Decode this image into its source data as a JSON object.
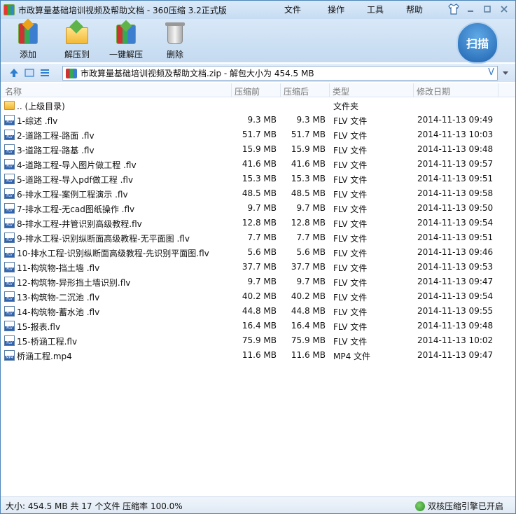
{
  "window": {
    "title": "市政算量基础培训视频及帮助文档 - 360压缩 3.2正式版",
    "menu": [
      "文件",
      "操作",
      "工具",
      "帮助"
    ]
  },
  "toolbar": {
    "add_label": "添加",
    "extract_label": "解压到",
    "one_click_label": "一键解压",
    "delete_label": "删除",
    "scan_label": "扫描"
  },
  "address": {
    "text": "市政算量基础培训视频及帮助文档.zip - 解包大小为 454.5 MB",
    "v_label": "V"
  },
  "columns": {
    "name": "名称",
    "size": "压缩前",
    "packed": "压缩后",
    "type": "类型",
    "date": "修改日期"
  },
  "files": [
    {
      "name": ".. (上级目录)",
      "size": "",
      "packed": "",
      "type": "文件夹",
      "date": "",
      "icon": "folder-icon"
    },
    {
      "name": "1-综述 .flv",
      "size": "9.3 MB",
      "packed": "9.3 MB",
      "type": "FLV 文件",
      "date": "2014-11-13 09:49",
      "icon": "flv-file-icon"
    },
    {
      "name": "2-道路工程-路面 .flv",
      "size": "51.7 MB",
      "packed": "51.7 MB",
      "type": "FLV 文件",
      "date": "2014-11-13 10:03",
      "icon": "flv-file-icon"
    },
    {
      "name": "3-道路工程-路基 .flv",
      "size": "15.9 MB",
      "packed": "15.9 MB",
      "type": "FLV 文件",
      "date": "2014-11-13 09:48",
      "icon": "flv-file-icon"
    },
    {
      "name": "4-道路工程-导入图片做工程 .flv",
      "size": "41.6 MB",
      "packed": "41.6 MB",
      "type": "FLV 文件",
      "date": "2014-11-13 09:57",
      "icon": "flv-file-icon"
    },
    {
      "name": "5-道路工程-导入pdf做工程 .flv",
      "size": "15.3 MB",
      "packed": "15.3 MB",
      "type": "FLV 文件",
      "date": "2014-11-13 09:51",
      "icon": "flv-file-icon"
    },
    {
      "name": "6-排水工程-案例工程演示 .flv",
      "size": "48.5 MB",
      "packed": "48.5 MB",
      "type": "FLV 文件",
      "date": "2014-11-13 09:58",
      "icon": "flv-file-icon"
    },
    {
      "name": "7-排水工程-无cad图纸操作 .flv",
      "size": "9.7 MB",
      "packed": "9.7 MB",
      "type": "FLV 文件",
      "date": "2014-11-13 09:50",
      "icon": "flv-file-icon"
    },
    {
      "name": "8-排水工程-井管识别高级教程.flv",
      "size": "12.8 MB",
      "packed": "12.8 MB",
      "type": "FLV 文件",
      "date": "2014-11-13 09:54",
      "icon": "flv-file-icon"
    },
    {
      "name": "9-排水工程-识别纵断面高级教程-无平面图 .flv",
      "size": "7.7 MB",
      "packed": "7.7 MB",
      "type": "FLV 文件",
      "date": "2014-11-13 09:51",
      "icon": "flv-file-icon"
    },
    {
      "name": "10-排水工程-识别纵断面高级教程-先识别平面图.flv",
      "size": "5.6 MB",
      "packed": "5.6 MB",
      "type": "FLV 文件",
      "date": "2014-11-13 09:46",
      "icon": "flv-file-icon"
    },
    {
      "name": "11-构筑物-挡土墙 .flv",
      "size": "37.7 MB",
      "packed": "37.7 MB",
      "type": "FLV 文件",
      "date": "2014-11-13 09:53",
      "icon": "flv-file-icon"
    },
    {
      "name": "12-构筑物-异形挡土墙识别.flv",
      "size": "9.7 MB",
      "packed": "9.7 MB",
      "type": "FLV 文件",
      "date": "2014-11-13 09:47",
      "icon": "flv-file-icon"
    },
    {
      "name": "13-构筑物-二沉池 .flv",
      "size": "40.2 MB",
      "packed": "40.2 MB",
      "type": "FLV 文件",
      "date": "2014-11-13 09:54",
      "icon": "flv-file-icon"
    },
    {
      "name": "14-构筑物-蓄水池 .flv",
      "size": "44.8 MB",
      "packed": "44.8 MB",
      "type": "FLV 文件",
      "date": "2014-11-13 09:55",
      "icon": "flv-file-icon"
    },
    {
      "name": "15-报表.flv",
      "size": "16.4 MB",
      "packed": "16.4 MB",
      "type": "FLV 文件",
      "date": "2014-11-13 09:48",
      "icon": "flv-file-icon"
    },
    {
      "name": "15-桥涵工程.flv",
      "size": "75.9 MB",
      "packed": "75.9 MB",
      "type": "FLV 文件",
      "date": "2014-11-13 10:02",
      "icon": "flv-file-icon"
    },
    {
      "name": "桥涵工程.mp4",
      "size": "11.6 MB",
      "packed": "11.6 MB",
      "type": "MP4 文件",
      "date": "2014-11-13 09:47",
      "icon": "mp4-file-icon"
    }
  ],
  "status": {
    "left": "大小: 454.5 MB 共 17 个文件 压缩率 100.0%",
    "right": "双核压缩引擎已开启"
  }
}
